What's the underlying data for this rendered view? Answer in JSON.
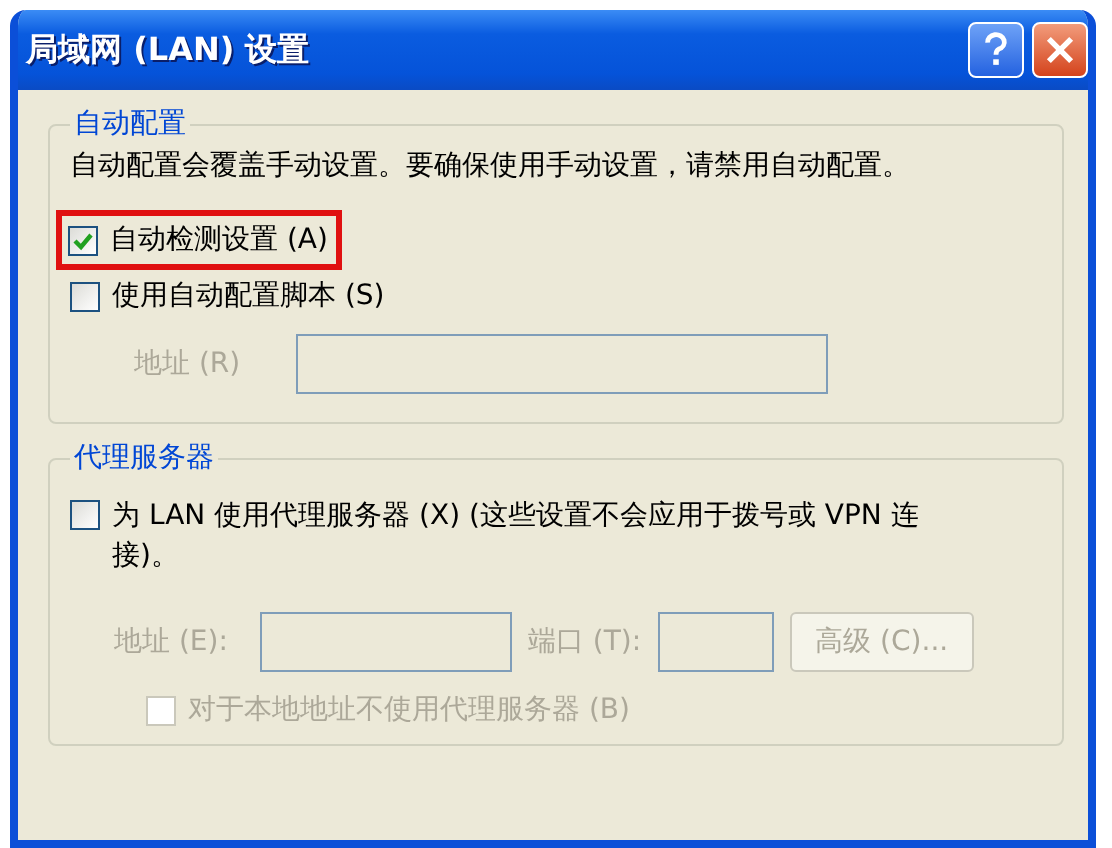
{
  "window": {
    "title": "局域网 (LAN) 设置"
  },
  "auto_config": {
    "title": "自动配置",
    "description": "自动配置会覆盖手动设置。要确保使用手动设置，请禁用自动配置。",
    "auto_detect": {
      "label": "自动检测设置 (A)",
      "checked": true,
      "highlighted": true
    },
    "use_script": {
      "label": "使用自动配置脚本 (S)",
      "checked": false
    },
    "address": {
      "label": "地址 (R)",
      "disabled": true
    }
  },
  "proxy": {
    "title": "代理服务器",
    "use_proxy": {
      "label": "为 LAN 使用代理服务器 (X) (这些设置不会应用于拨号或 VPN 连接)。",
      "checked": false
    },
    "address": {
      "label": "地址 (E):",
      "disabled": true
    },
    "port": {
      "label": "端口 (T):",
      "disabled": true
    },
    "advanced_button": {
      "label": "高级 (C)...",
      "disabled": true
    },
    "bypass_local": {
      "label": "对于本地地址不使用代理服务器 (B)",
      "checked": false,
      "disabled": true
    }
  }
}
